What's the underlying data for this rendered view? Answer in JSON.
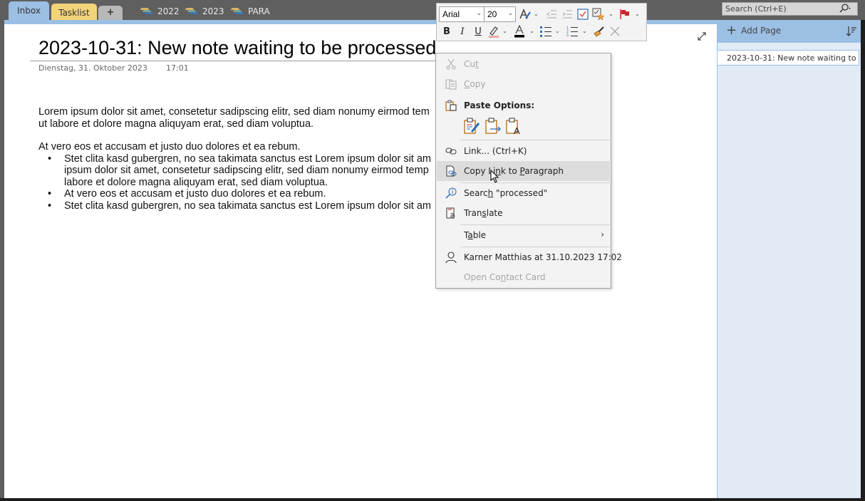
{
  "tabs": {
    "sections": [
      {
        "label": "Inbox",
        "color": "#9cbfe4",
        "active": true
      },
      {
        "label": "Tasklist",
        "color": "#f2d37a",
        "active": false
      }
    ],
    "add_label": "+",
    "notebooks": [
      {
        "label": "2022",
        "icon": "notebook-group-icon"
      },
      {
        "label": "2023",
        "icon": "notebook-group-icon"
      },
      {
        "label": "PARA",
        "icon": "notebook-group-icon"
      }
    ]
  },
  "search": {
    "placeholder": "Search (Ctrl+E)"
  },
  "page": {
    "title": "2023-10-31: New note waiting to be processed",
    "date": "Dienstag, 31. Oktober 2023",
    "time": "17:01",
    "paragraphs": [
      "Lorem ipsum dolor sit amet, consetetur sadipscing elitr, sed diam nonumy eirmod tem",
      "ut labore et dolore magna aliquyam erat, sed diam voluptua."
    ],
    "paragraph2": "At vero eos et accusam et justo duo dolores et ea rebum.",
    "bullets": [
      [
        "Stet clita kasd gubergren, no sea takimata sanctus est Lorem ipsum dolor sit am",
        "ipsum dolor sit amet, consetetur sadipscing elitr, sed diam nonumy eirmod temp",
        "labore et dolore magna aliquyam erat, sed diam voluptua."
      ],
      [
        "At vero eos et accusam et justo duo dolores et ea rebum."
      ],
      [
        "Stet clita kasd gubergren, no sea takimata sanctus est Lorem ipsum dolor sit am"
      ]
    ]
  },
  "pagelist": {
    "add_page_label": "Add Page",
    "pages": [
      "2023-10-31: New note waiting to"
    ]
  },
  "minibar": {
    "font": "Arial",
    "size": "20",
    "buttons": [
      "format-painter-style",
      "decrease-indent",
      "increase-indent",
      "todo-tag",
      "tags",
      "flag",
      "bold",
      "italic",
      "underline",
      "highlight",
      "font-color",
      "bullets",
      "numbering",
      "format-painter",
      "clear-formatting"
    ],
    "bold": "B",
    "italic": "I",
    "underline": "U",
    "font_color_letter": "A",
    "highlight_color": "#e8a8a8",
    "font_color": "#000000"
  },
  "context_menu": {
    "cut": {
      "pre": "Cu",
      "u": "t",
      "post": "",
      "disabled": true
    },
    "copy": {
      "pre": "",
      "u": "C",
      "post": "opy",
      "disabled": true
    },
    "paste_options": "Paste Options:",
    "link": "Link...  (Ctrl+K)",
    "copy_link": {
      "pre": "Copy Li",
      "u": "n",
      "mid": "k to ",
      "u2": "P",
      "post": "aragraph"
    },
    "search": {
      "pre": "Searc",
      "u": "h",
      "post": " \"processed\""
    },
    "translate": {
      "pre": "Tran",
      "u": "s",
      "post": "late"
    },
    "table": {
      "pre": "T",
      "u": "a",
      "post": "ble"
    },
    "author": "Karner Matthias at 31.10.2023 17:02",
    "contact": {
      "pre": "Open Co",
      "u": "n",
      "post": "tact Card",
      "disabled": true
    }
  }
}
